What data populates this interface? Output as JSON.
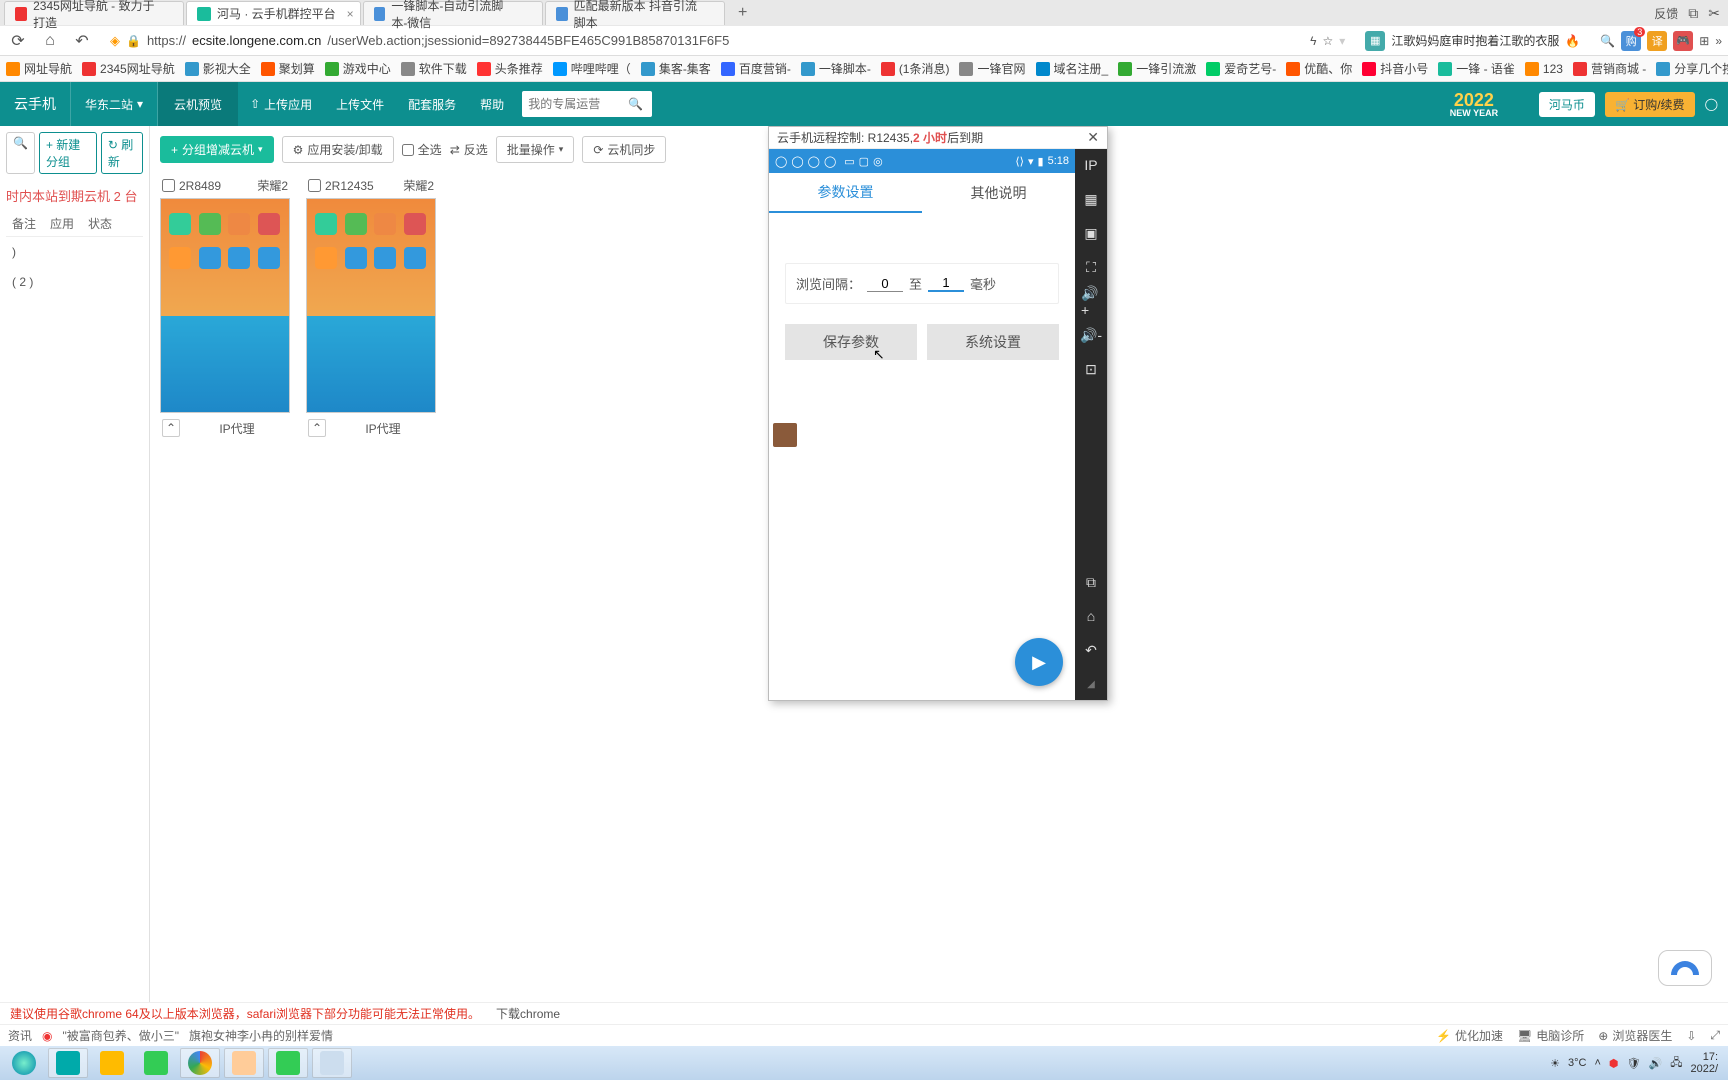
{
  "tabs": [
    {
      "label": "2345网址导航 - 致力于打造",
      "favcolor": "#e33"
    },
    {
      "label": "河马 · 云手机群控平台",
      "favcolor": "#1abc9c",
      "active": true
    },
    {
      "label": "一锋脚本-自动引流脚本-微信",
      "favcolor": "#4a90d9"
    },
    {
      "label": "匹配最新版本 抖音引流脚本",
      "favcolor": "#4a90d9"
    }
  ],
  "tab_feedback": "反馈",
  "url": {
    "host": "ecsite.longene.com.cn",
    "path": "/userWeb.action;jsessionid=892738445BFE465C991B85870131F6F5"
  },
  "hot_news": "江歌妈妈庭审时抱着江歌的衣服",
  "bookmarks": [
    "网址导航",
    "2345网址导航",
    "影视大全",
    "聚划算",
    "游戏中心",
    "软件下载",
    "头条推荐",
    "哔哩哔哩（",
    "集客-集客",
    "百度营销-",
    "一锋脚本-",
    "(1条消息)",
    "一锋官网",
    "域名注册_",
    "一锋引流激",
    "爱奇艺号-",
    "优酷、你",
    "抖音小号",
    "一锋 - 语雀",
    "123",
    "营销商城 -",
    "分享几个按"
  ],
  "site": {
    "title": "云手机",
    "station": "华东二站",
    "nav": [
      "云机预览",
      "上传应用",
      "上传文件",
      "配套服务",
      "帮助"
    ],
    "search_ph": "我的专属运营",
    "ny": "2022 NEW YEAR",
    "coin": "河马币",
    "order": "订购/续费"
  },
  "left": {
    "new_group": "新建分组",
    "refresh": "刷新",
    "alert": "时内本站到期云机 2 台",
    "tabs": [
      "备注",
      "应用",
      "状态"
    ],
    "items": [
      ")",
      "( 2 )"
    ]
  },
  "toolbar": {
    "group": "分组增减云机",
    "install": "应用安装/卸载",
    "all": "全选",
    "invert": "反选",
    "batch": "批量操作",
    "sync": "云机同步"
  },
  "phones": [
    {
      "id": "2R8489",
      "name": "荣耀2",
      "proxy": "IP代理"
    },
    {
      "id": "2R12435",
      "name": "荣耀2",
      "proxy": "IP代理"
    }
  ],
  "modal": {
    "title_pre": "云手机远程控制: R12435, ",
    "expire": "2 小时",
    "title_post": " 后到期",
    "status_time": "5:18",
    "tab1": "参数设置",
    "tab2": "其他说明",
    "interval_label": "浏览间隔：",
    "to": "至",
    "unit": "毫秒",
    "val_from": "0",
    "val_to": "1",
    "save": "保存参数",
    "sys": "系统设置"
  },
  "warn": {
    "text": "建议使用谷歌chrome 64及以上版本浏览器，safari浏览器下部分功能可能无法正常使用。",
    "link": "下载chrome"
  },
  "ticker": {
    "brand": "资讯",
    "n1": "\"被富商包养、做小三\"",
    "n2": "旗袍女神李小冉的别样爱情",
    "r": [
      "优化加速",
      "电脑诊所",
      "浏览器医生"
    ]
  },
  "taskbar": {
    "temp": "3°C",
    "time": "17:",
    "date": "2022/"
  },
  "badge_count": "3"
}
